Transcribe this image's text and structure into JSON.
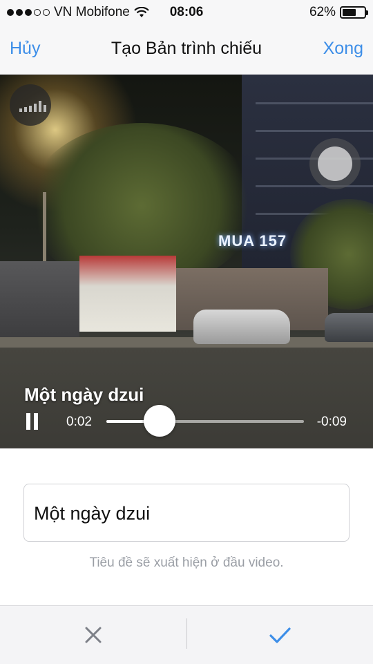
{
  "status_bar": {
    "carrier": "VN Mobifone",
    "time": "08:06",
    "battery_percent_label": "62%",
    "battery_level": 0.62,
    "signal_bars_filled": 3,
    "signal_bars_total": 5,
    "icons": [
      "signal-dots-icon",
      "wifi-icon",
      "battery-icon"
    ]
  },
  "nav": {
    "cancel_label": "Hủy",
    "title": "Tạo Bản trình chiếu",
    "done_label": "Xong",
    "accent_color": "#3d8ee8"
  },
  "video": {
    "overlay_title": "Một ngày dzui",
    "elapsed": "0:02",
    "remaining": "-0:09",
    "progress": 0.27,
    "icons": [
      "audio-levels-icon",
      "pause-icon",
      "assistive-touch-icon"
    ],
    "scene_sign_text": "MUA 157"
  },
  "form": {
    "title_value": "Một ngày dzui",
    "hint": "Tiêu đề sẽ xuất hiện ở đầu video."
  },
  "toolbar": {
    "icons": [
      "close-icon",
      "checkmark-icon"
    ],
    "checkmark_color": "#3d8ee8",
    "close_color": "#7d8088"
  }
}
